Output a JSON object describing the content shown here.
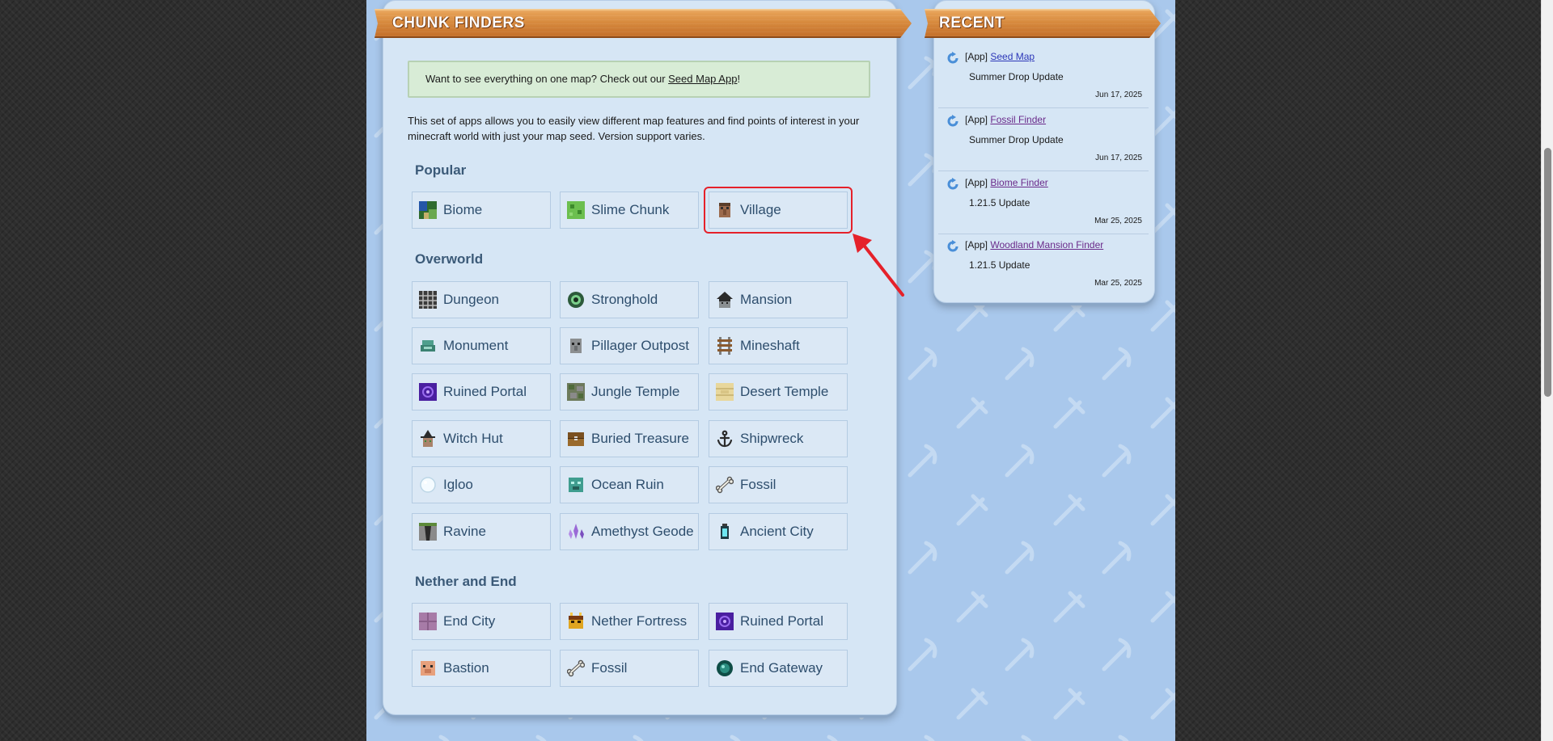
{
  "chunk_finders": {
    "title": "CHUNK FINDERS",
    "notice_prefix": "Want to see everything on one map? Check out our ",
    "notice_link": "Seed Map App",
    "notice_suffix": "!",
    "intro": "This set of apps allows you to easily view different map features and find points of interest in your minecraft world with just your map seed. Version support varies.",
    "sections": {
      "popular": "Popular",
      "overworld": "Overworld",
      "nether_end": "Nether and End"
    },
    "popular": [
      "Biome",
      "Slime Chunk",
      "Village"
    ],
    "overworld": [
      "Dungeon",
      "Stronghold",
      "Mansion",
      "Monument",
      "Pillager Outpost",
      "Mineshaft",
      "Ruined Portal",
      "Jungle Temple",
      "Desert Temple",
      "Witch Hut",
      "Buried Treasure",
      "Shipwreck",
      "Igloo",
      "Ocean Ruin",
      "Fossil",
      "Ravine",
      "Amethyst Geode",
      "Ancient City"
    ],
    "nether_end": [
      "End City",
      "Nether Fortress",
      "Ruined Portal",
      "Bastion",
      "Fossil",
      "End Gateway"
    ]
  },
  "recent": {
    "title": "RECENT",
    "items": [
      {
        "tag": "[App]",
        "link": "Seed Map",
        "desc": "Summer Drop Update",
        "date": "Jun 17, 2025"
      },
      {
        "tag": "[App]",
        "link": "Fossil Finder",
        "desc": "Summer Drop Update",
        "date": "Jun 17, 2025"
      },
      {
        "tag": "[App]",
        "link": "Biome Finder",
        "desc": "1.21.5 Update",
        "date": "Mar 25, 2025"
      },
      {
        "tag": "[App]",
        "link": "Woodland Mansion Finder",
        "desc": "1.21.5 Update",
        "date": "Mar 25, 2025"
      }
    ]
  },
  "colors": {
    "page_bg": "#2e2e2e",
    "content_bg": "#a9c8ec",
    "panel_bg": "#d6e6f5",
    "banner_wood": "#d78a3e",
    "button_text": "#2e4e6d",
    "highlight": "#e5212a"
  }
}
